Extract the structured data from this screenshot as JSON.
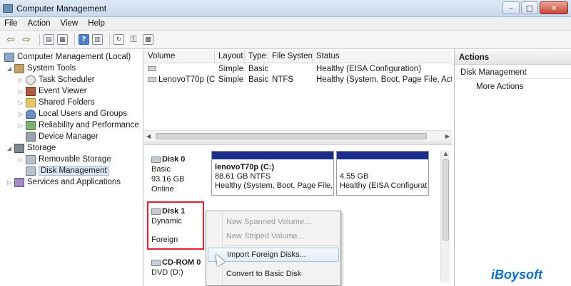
{
  "window": {
    "title": "Computer Management"
  },
  "menubar": [
    "File",
    "Action",
    "View",
    "Help"
  ],
  "toolbar": {
    "back_icon": "back-arrow-icon",
    "forward_icon": "forward-arrow-icon"
  },
  "tree": {
    "root": "Computer Management (Local)",
    "system_tools": "System Tools",
    "task_scheduler": "Task Scheduler",
    "event_viewer": "Event Viewer",
    "shared_folders": "Shared Folders",
    "local_users": "Local Users and Groups",
    "reliability": "Reliability and Performance",
    "device_manager": "Device Manager",
    "storage": "Storage",
    "removable_storage": "Removable Storage",
    "disk_management": "Disk Management",
    "services": "Services and Applications"
  },
  "volumes": {
    "columns": [
      "Volume",
      "Layout",
      "Type",
      "File System",
      "Status"
    ],
    "rows": [
      {
        "volume": "",
        "layout": "Simple",
        "type": "Basic",
        "fs": "",
        "status": "Healthy (EISA Configuration)"
      },
      {
        "volume": "LenovoT70p (C:)",
        "layout": "Simple",
        "type": "Basic",
        "fs": "NTFS",
        "status": "Healthy (System, Boot, Page File, Active"
      }
    ]
  },
  "disks": {
    "disk0": {
      "name": "Disk 0",
      "type": "Basic",
      "size": "93.16 GB",
      "state": "Online",
      "part1": {
        "title": "lenovoT70p (C:)",
        "size": "88.61 GB NTFS",
        "status": "Healthy (System, Boot, Page File, A"
      },
      "part2": {
        "size": "4.55 GB",
        "status": "Healthy (EISA Configurat"
      }
    },
    "disk1": {
      "name": "Disk 1",
      "type": "Dynamic",
      "state": "Foreign"
    },
    "cdrom": {
      "name": "CD-ROM 0",
      "drive": "DVD (D:)"
    }
  },
  "context_menu": {
    "items": [
      {
        "label": "New Spanned Volume...",
        "enabled": false
      },
      {
        "label": "New Striped Volume...",
        "enabled": false
      },
      {
        "label": "Import Foreign Disks...",
        "enabled": true
      },
      {
        "label": "Convert to Basic Disk",
        "enabled": true
      }
    ]
  },
  "actions": {
    "header": "Actions",
    "section": "Disk Management",
    "more": "More Actions"
  },
  "watermark": "iBoysoft",
  "colors": {
    "partition_bar": "#1b2e8c",
    "highlight": "#e2232a",
    "watermark": "#0b6fd0"
  }
}
